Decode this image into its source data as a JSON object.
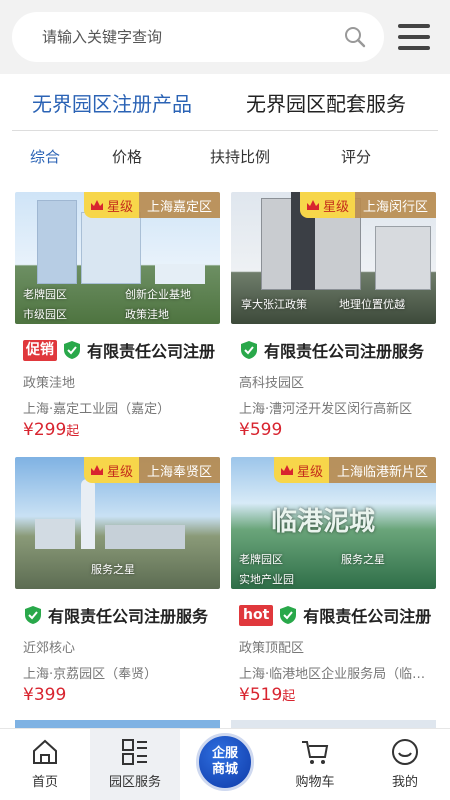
{
  "search": {
    "placeholder": "请输入关键字查询"
  },
  "main_tabs": [
    {
      "label": "无界园区注册产品",
      "active": true
    },
    {
      "label": "无界园区配套服务",
      "active": false
    }
  ],
  "sort_tabs": [
    {
      "label": "综合",
      "active": true
    },
    {
      "label": "价格"
    },
    {
      "label": "扶持比例"
    },
    {
      "label": "评分"
    }
  ],
  "star_label": "星级",
  "cards": [
    {
      "region": "上海嘉定区",
      "image_labels": [
        "老牌园区",
        "创新企业基地",
        "市级园区",
        "政策洼地"
      ],
      "badge": "促销",
      "title": "有限责任公司注册",
      "category": "政策洼地",
      "location": "上海·嘉定工业园（嘉定）",
      "price": "¥299",
      "price_unit": "起"
    },
    {
      "region": "上海闵行区",
      "image_labels": [
        "享大张江政策",
        "地理位置优越"
      ],
      "badge": "",
      "title": "有限责任公司注册服务",
      "category": "高科技园区",
      "location": "上海·漕河泾开发区闵行高新区",
      "price": "¥599",
      "price_unit": ""
    },
    {
      "region": "上海奉贤区",
      "image_labels": [
        "服务之星"
      ],
      "badge": "",
      "title": "有限责任公司注册服务",
      "category": "近郊核心",
      "location": "上海·京荔园区（奉贤）",
      "price": "¥399",
      "price_unit": ""
    },
    {
      "region": "上海临港新片区",
      "image_labels": [
        "老牌园区",
        "服务之星",
        "实地产业园"
      ],
      "image_banner": "临港泥城",
      "badge": "hot",
      "title": "有限责任公司注册",
      "category": "政策顶配区",
      "location": "上海·临港地区企业服务局（临港）",
      "price": "¥519",
      "price_unit": "起"
    }
  ],
  "bottom_nav": [
    {
      "label": "首页",
      "icon": "home-icon"
    },
    {
      "label": "园区服务",
      "icon": "grid-list-icon",
      "active": true
    },
    {
      "label": "企服商城",
      "icon": "mall-badge"
    },
    {
      "label": "购物车",
      "icon": "cart-icon"
    },
    {
      "label": "我的",
      "icon": "profile-icon"
    }
  ],
  "center_button": {
    "line1": "企服",
    "line2": "商城"
  },
  "colors": {
    "accent": "#2b63b5",
    "price": "#d8242f",
    "badge": "#e0383c",
    "star_tag": "#f7d64a",
    "region_tag": "#b88c50",
    "shield": "#29a84a"
  }
}
